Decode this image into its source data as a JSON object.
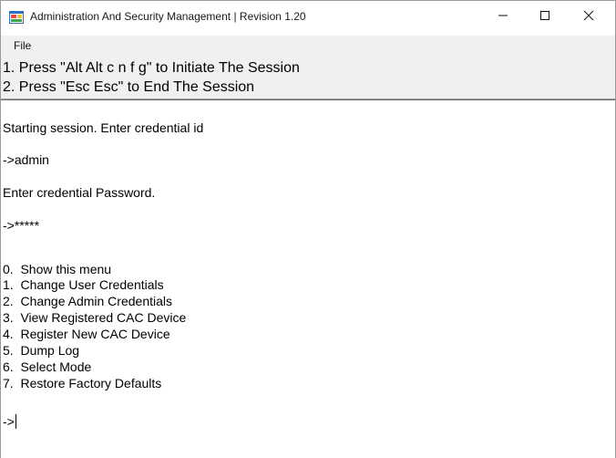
{
  "window": {
    "title": "Administration And Security Management  |  Revision 1.20"
  },
  "menubar": {
    "file_label": "File"
  },
  "instructions": {
    "line1": "1. Press \"Alt Alt c n f g\" to Initiate The Session",
    "line2": "2. Press \"Esc Esc\" to End The Session"
  },
  "console": {
    "starting": "Starting session. Enter credential id",
    "id_entry": "->admin",
    "password_prompt": "Enter credential Password.",
    "password_entry": "->*****",
    "menu_items": [
      "0.  Show this menu",
      "1.  Change User Credentials",
      "2.  Change Admin Credentials",
      "3.  View Registered CAC Device",
      "4.  Register New CAC Device",
      "5.  Dump Log",
      "6.  Select Mode",
      "7.  Restore Factory Defaults"
    ],
    "prompt": "->"
  }
}
